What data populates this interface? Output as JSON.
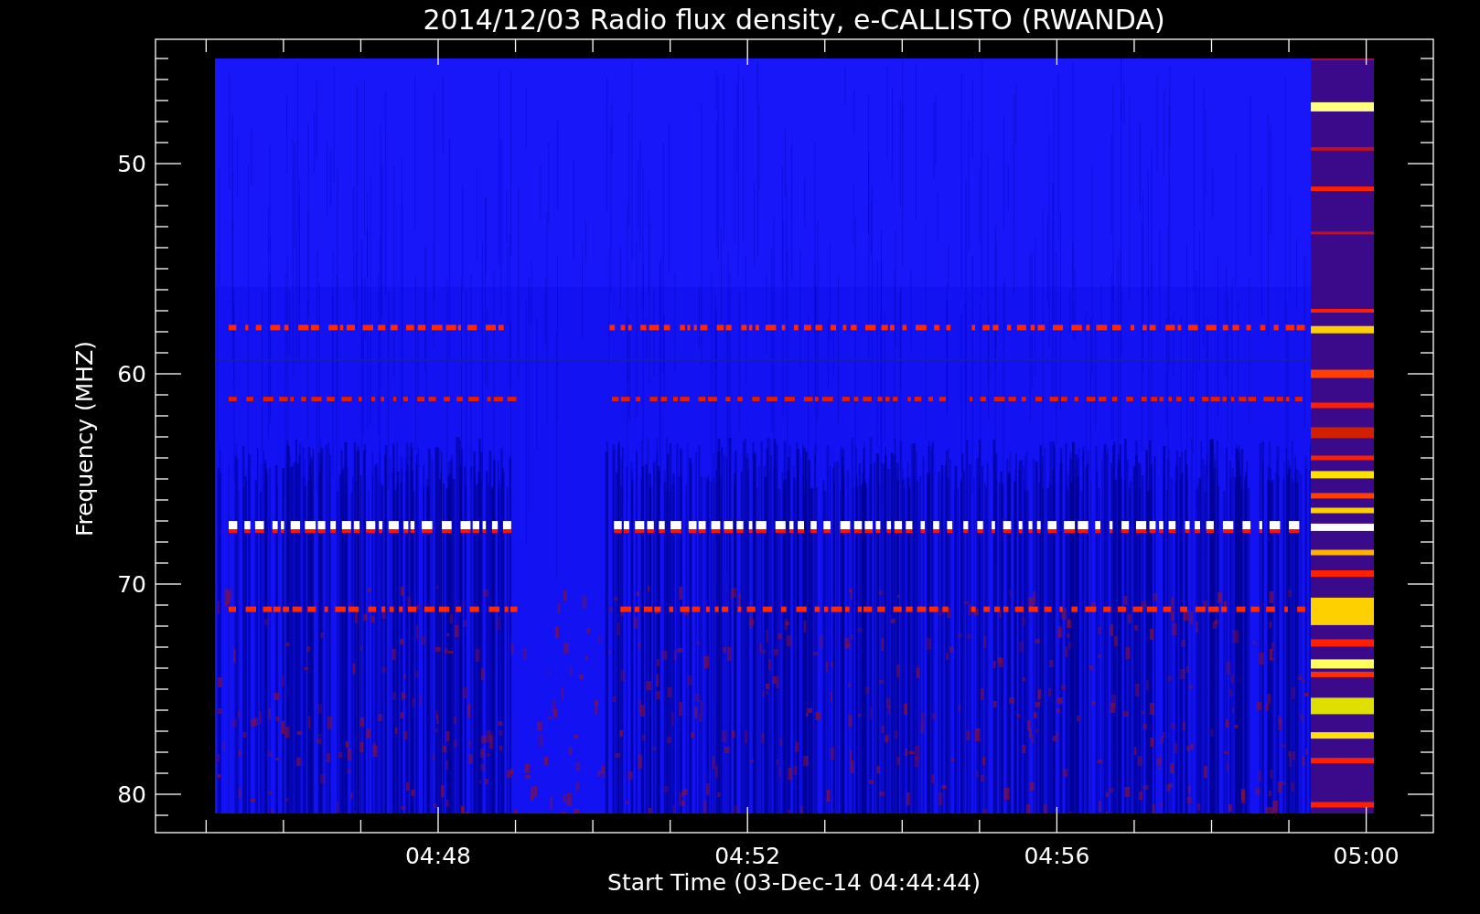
{
  "plot": {
    "title": "2014/12/03  Radio flux density, e-CALLISTO (RWANDA)",
    "ylabel": "Frequency (MHZ)",
    "xlabel": "Start Time (03-Dec-14 04:44:44)",
    "y_tick_labels": [
      "50",
      "60",
      "70",
      "80"
    ],
    "x_tick_labels": [
      "04:48",
      "04:52",
      "04:56",
      "05:00"
    ]
  }
}
